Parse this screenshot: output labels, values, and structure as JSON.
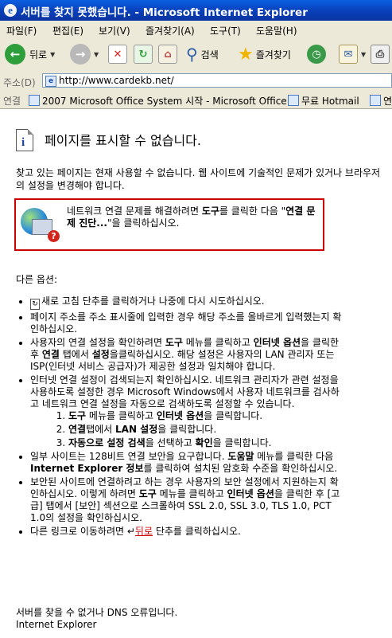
{
  "window": {
    "title": "서버를 찾지 못했습니다. - Microsoft Internet Explorer"
  },
  "menu": [
    "파일(F)",
    "편집(E)",
    "보기(V)",
    "즐겨찾기(A)",
    "도구(T)",
    "도움말(H)"
  ],
  "toolbar": {
    "back": "뒤로",
    "search": "검색",
    "favorites": "즐겨찾기"
  },
  "address": {
    "label": "주소(D)",
    "url": "http://www.cardekb.net/"
  },
  "links": {
    "label": "연결",
    "items": [
      "2007 Microsoft Office System 시작 - Microsoft Office",
      "무료 Hotmail",
      "연"
    ]
  },
  "page": {
    "heading": "페이지를 표시할 수 없습니다.",
    "intro": "찾고 있는 페이지는 현재 사용할 수 없습니다. 웹 사이트에 기술적인 문제가 있거나 브라우저의 설정을 변경해야 합니다.",
    "diag": {
      "a": "네트워크 연결 문제를 해결하려면 ",
      "b": "도구",
      "c": "를 클릭한 다음 \"",
      "d": "연결 문제 진단...",
      "e": "\"을 클릭하십시오."
    },
    "other": "다른 옵션:",
    "b1": "새로 고침 단추를 클릭하거나 나중에 다시 시도하십시오.",
    "b2": "페이지 주소를 주소 표시줄에 입력한 경우 해당 주소를 올바르게 입력했는지 확인하십시오.",
    "b3": {
      "a": "사용자의 연결 설정을 확인하려면 ",
      "b": "도구",
      "c": " 메뉴를 클릭하고 ",
      "d": "인터넷 옵션",
      "e": "을 클릭한 후 ",
      "f": "연결",
      "g": " 탭에서 ",
      "h": "설정",
      "i": "을클릭하십시오. 해당 설정은 사용자의 LAN 관리자 또는 ISP(인터넷 서비스 공급자)가 제공한 설정과 일치해야 합니다."
    },
    "b4": "인터넷 연결 설정이 검색되는지 확인하십시오. 네트워크 관리자가 관련 설정을 사용하도록 설정한 경우 Microsoft Windows에서 사용자 네트워크를 검사하고 네트워크 연결 설정을 자동으로 검색하도록 설정할 수 있습니다.",
    "s1": {
      "a": "도구",
      "b": " 메뉴를 클릭하고 ",
      "c": "인터넷 옵션",
      "d": "을 클릭합니다."
    },
    "s2": {
      "a": "연결",
      "b": "탭에서 ",
      "c": "LAN 설정",
      "d": "을 클릭합니다."
    },
    "s3": {
      "a": "자동으로 설정 검색",
      "b": "을 선택하고 ",
      "c": "확인",
      "d": "을 클릭합니다."
    },
    "b5": {
      "a": "일부 사이트는 128비트 연결 보안을 요구합니다. ",
      "b": "도움말",
      "c": " 메뉴를 클릭한 다음 ",
      "d": "Internet Explorer 정보",
      "e": "를 클릭하여 설치된 암호화 수준을 확인하십시오."
    },
    "b6": {
      "a": "보안된 사이트에 연결하려고 하는 경우 사용자의 보안 설정에서 지원하는지 확인하십시오. 이렇게 하려면 ",
      "b": "도구",
      "c": " 메뉴를 클릭하고 ",
      "d": "인터넷 옵션",
      "e": "을 클릭한 후 [고급] 탭에서 [보안] 섹션으로 스크롤하여 SSL 2.0, SSL 3.0, TLS 1.0, PCT 1.0의 설정을 확인하십시오."
    },
    "b7": {
      "a": "다른 링크로 이동하려면 ",
      "link": "뒤로",
      "b": " 단추를 클릭하십시오."
    },
    "footer1": "서버를 찾을 수 없거나 DNS 오류입니다.",
    "footer2": "Internet Explorer"
  },
  "colors": {
    "title_bar": "#0a4fd0",
    "chrome": "#ece9d8",
    "diag_border": "#cc0000",
    "link": "#cc0000"
  }
}
